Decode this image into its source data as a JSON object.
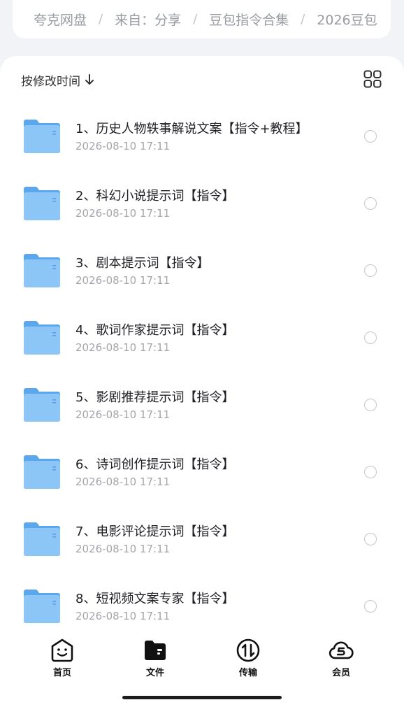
{
  "breadcrumb": [
    "夸克网盘",
    "来自：分享",
    "豆包指令合集",
    "2026豆包"
  ],
  "toolbar": {
    "sort_label": "按修改时间",
    "sort_icon": "arrow-down-icon",
    "view_icon": "grid-view-icon"
  },
  "files": [
    {
      "name": "1、历史人物轶事解说文案【指令+教程】",
      "date": "2026-08-10 17:11"
    },
    {
      "name": "2、科幻小说提示词【指令】",
      "date": "2026-08-10 17:11"
    },
    {
      "name": "3、剧本提示词【指令】",
      "date": "2026-08-10 17:11"
    },
    {
      "name": "4、歌词作家提示词【指令】",
      "date": "2026-08-10 17:11"
    },
    {
      "name": "5、影剧推荐提示词【指令】",
      "date": "2026-08-10 17:11"
    },
    {
      "name": "6、诗词创作提示词【指令】",
      "date": "2026-08-10 17:11"
    },
    {
      "name": "7、电影评论提示词【指令】",
      "date": "2026-08-10 17:11"
    },
    {
      "name": "8、短视频文案专家【指令】",
      "date": "2026-08-10 17:11"
    }
  ],
  "nav": [
    {
      "label": "首页",
      "icon": "home-face-icon"
    },
    {
      "label": "文件",
      "icon": "folder-icon"
    },
    {
      "label": "传输",
      "icon": "transfer-icon"
    },
    {
      "label": "会员",
      "icon": "vip-cloud-icon"
    }
  ],
  "colors": {
    "folder": "#5aa7ee",
    "background": "#f2f3f7",
    "muted_text": "#a4a6ac"
  }
}
